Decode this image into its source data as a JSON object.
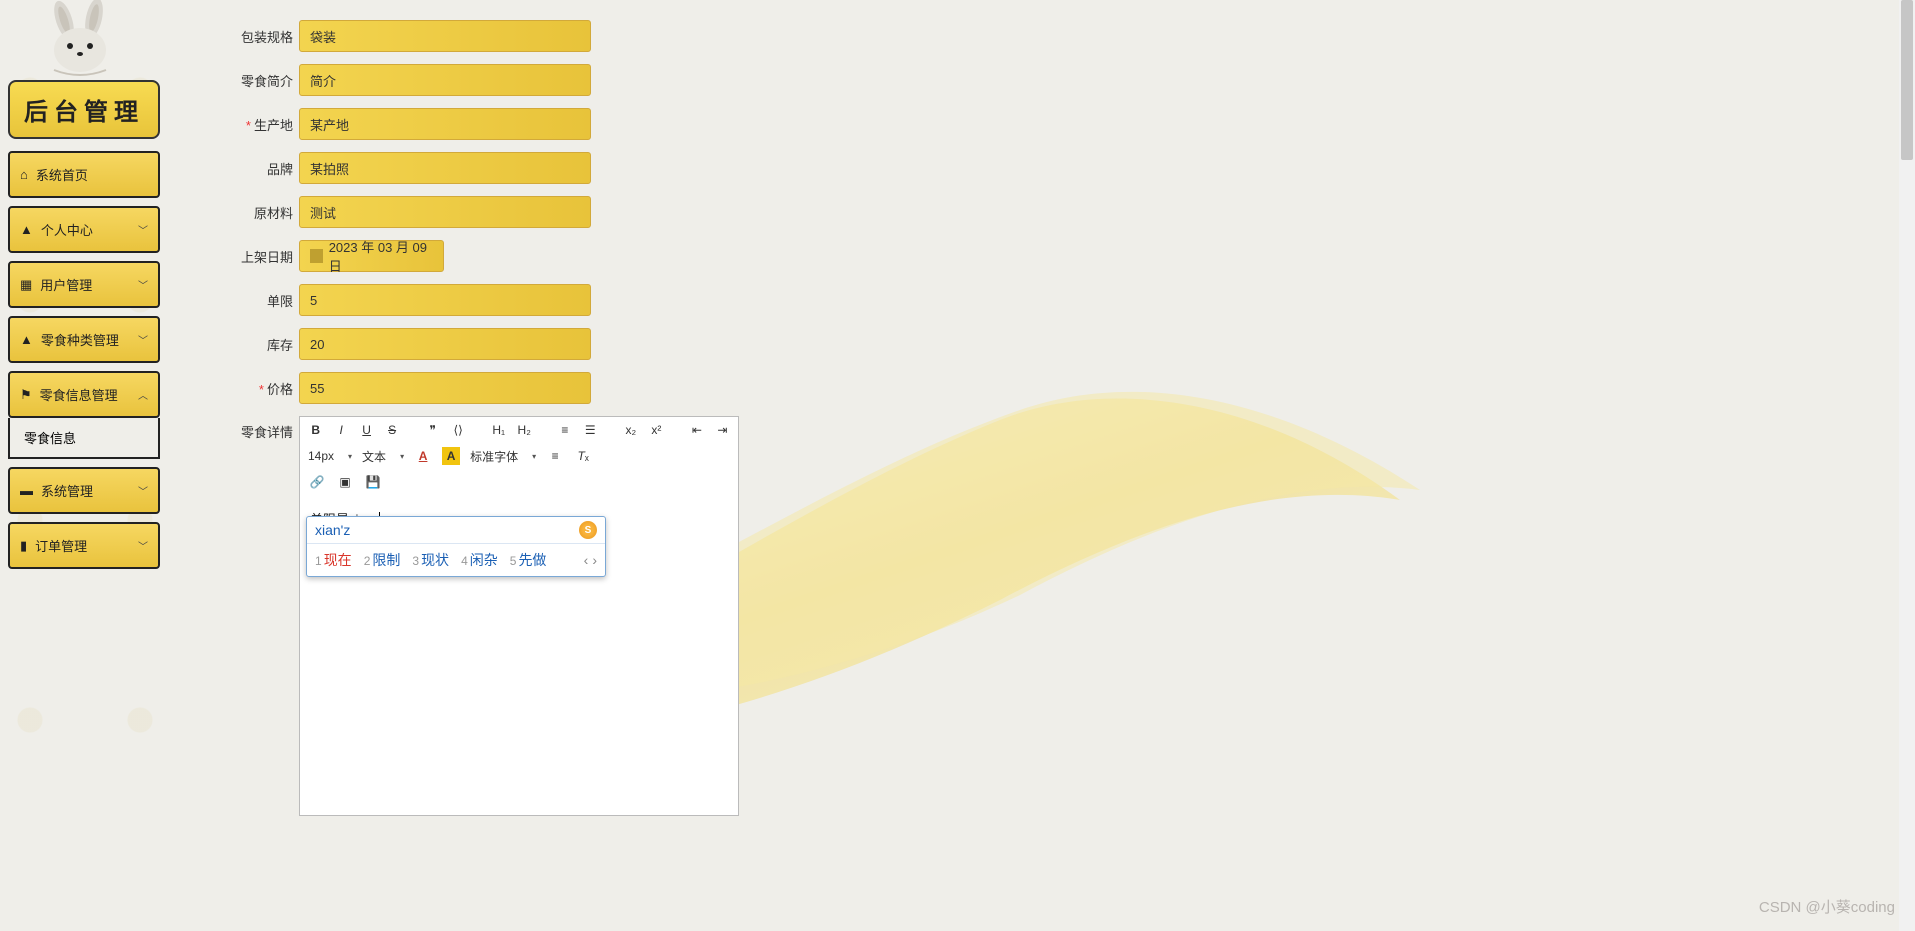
{
  "brand": "后台管理",
  "sidebar": {
    "items": [
      {
        "icon": "home-icon",
        "label": "系统首页",
        "expandable": false
      },
      {
        "icon": "user-icon",
        "label": "个人中心",
        "expandable": true
      },
      {
        "icon": "grid-icon",
        "label": "用户管理",
        "expandable": true
      },
      {
        "icon": "person-icon",
        "label": "零食种类管理",
        "expandable": true
      },
      {
        "icon": "flag-icon",
        "label": "零食信息管理",
        "expandable": true,
        "expanded": true,
        "children": [
          {
            "label": "零食信息"
          }
        ]
      },
      {
        "icon": "chat-icon",
        "label": "系统管理",
        "expandable": true
      },
      {
        "icon": "ticket-icon",
        "label": "订单管理",
        "expandable": true
      }
    ]
  },
  "form": {
    "package_spec": {
      "label": "包装规格",
      "value": "袋装"
    },
    "intro": {
      "label": "零食简介",
      "value": "简介"
    },
    "origin": {
      "label": "生产地",
      "value": "某产地",
      "required": true
    },
    "brand_field": {
      "label": "品牌",
      "value": "某拍照"
    },
    "material": {
      "label": "原材料",
      "value": "测试"
    },
    "onshelf_date": {
      "label": "上架日期",
      "value": "2023 年 03 月 09 日"
    },
    "limit": {
      "label": "单限",
      "value": "5"
    },
    "stock": {
      "label": "库存",
      "value": "20"
    },
    "price": {
      "label": "价格",
      "value": "55",
      "required": true
    },
    "detail_label": "零食详情"
  },
  "editor": {
    "font_size": "14px",
    "style_select": "文本",
    "font_family": "标准字体",
    "content": "单限是xianz"
  },
  "ime": {
    "input": "xian'z",
    "candidates": [
      {
        "n": "1",
        "text": "现在"
      },
      {
        "n": "2",
        "text": "限制"
      },
      {
        "n": "3",
        "text": "现状"
      },
      {
        "n": "4",
        "text": "闲杂"
      },
      {
        "n": "5",
        "text": "先做"
      }
    ]
  },
  "watermark": "CSDN @小葵coding"
}
